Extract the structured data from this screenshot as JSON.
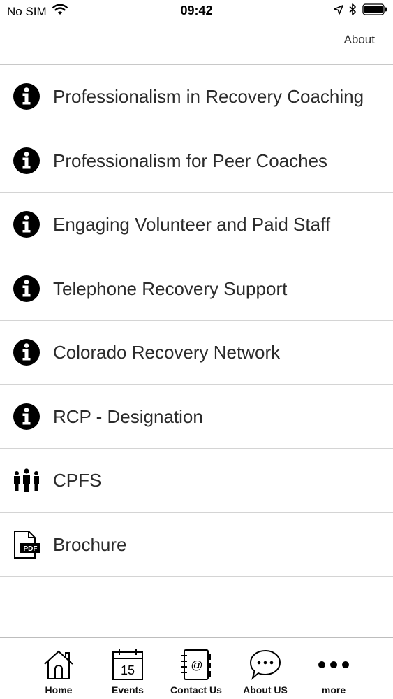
{
  "status_bar": {
    "carrier": "No SIM",
    "time": "09:42"
  },
  "nav": {
    "about_label": "About"
  },
  "menu": {
    "items": [
      {
        "label": "Professionalism in Recovery Coaching",
        "icon": "info-icon"
      },
      {
        "label": "Professionalism for Peer Coaches",
        "icon": "info-icon"
      },
      {
        "label": "Engaging Volunteer and Paid Staff",
        "icon": "info-icon"
      },
      {
        "label": "Telephone Recovery Support",
        "icon": "info-icon"
      },
      {
        "label": "Colorado Recovery Network",
        "icon": "info-icon"
      },
      {
        "label": "RCP - Designation",
        "icon": "info-icon"
      },
      {
        "label": "CPFS",
        "icon": "people-icon"
      },
      {
        "label": "Brochure",
        "icon": "pdf-icon"
      }
    ]
  },
  "tab_bar": {
    "tabs": [
      {
        "label": "Home",
        "icon": "home-icon"
      },
      {
        "label": "Events",
        "icon": "calendar-icon",
        "day": "15"
      },
      {
        "label": "Contact Us",
        "icon": "address-book-icon"
      },
      {
        "label": "About US",
        "icon": "chat-bubble-icon"
      },
      {
        "label": "more",
        "icon": "more-dots-icon"
      }
    ]
  }
}
